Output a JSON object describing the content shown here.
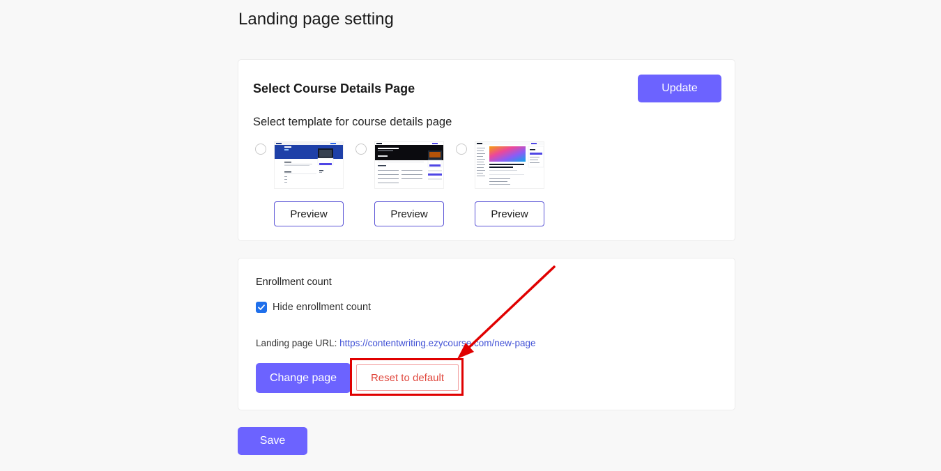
{
  "page": {
    "title": "Landing page setting"
  },
  "templates_card": {
    "title": "Select Course Details Page",
    "update_label": "Update",
    "subtitle": "Select template for course details page",
    "templates": [
      {
        "preview_label": "Preview"
      },
      {
        "preview_label": "Preview"
      },
      {
        "preview_label": "Preview"
      }
    ]
  },
  "enrollment_card": {
    "section_label": "Enrollment count",
    "hide_checkbox_label": "Hide enrollment count",
    "hide_checkbox_checked": true,
    "url_label": "Landing page URL:",
    "url_value": "https://contentwriting.ezycourse.com/new-page",
    "change_page_label": "Change page",
    "reset_label": "Reset to default"
  },
  "footer": {
    "save_label": "Save"
  },
  "colors": {
    "primary": "#6c63ff",
    "annotation": "#e00000",
    "reset_text": "#e0473d",
    "link": "#4353d6"
  }
}
